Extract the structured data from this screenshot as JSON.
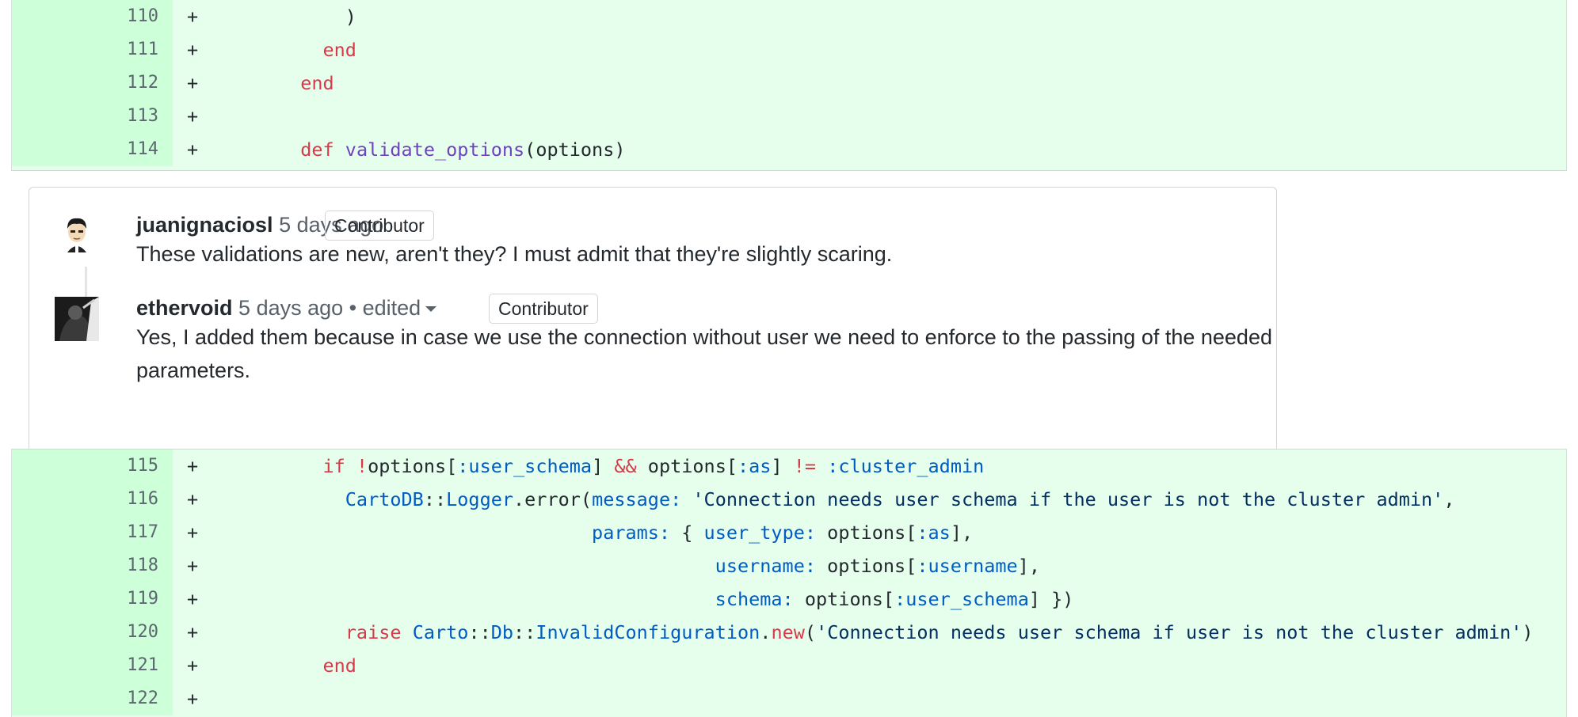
{
  "diff_top": [
    {
      "num": "110",
      "code": [
        {
          "t": "            )"
        }
      ]
    },
    {
      "num": "111",
      "code": [
        {
          "t": "          "
        },
        {
          "t": "end",
          "c": "kw"
        }
      ]
    },
    {
      "num": "112",
      "code": [
        {
          "t": "        "
        },
        {
          "t": "end",
          "c": "kw"
        }
      ]
    },
    {
      "num": "113",
      "code": []
    },
    {
      "num": "114",
      "code": [
        {
          "t": "        "
        },
        {
          "t": "def",
          "c": "kw"
        },
        {
          "t": " "
        },
        {
          "t": "validate_options",
          "c": "fn"
        },
        {
          "t": "(options)"
        }
      ]
    }
  ],
  "comments": {
    "first": {
      "author": "juanignaciosl",
      "time": "5 days ago",
      "badge": "Contributor",
      "body": "These validations are new, aren't they? I must admit that they're slightly scaring."
    },
    "second": {
      "author": "ethervoid",
      "time": "5 days ago",
      "edited": "• edited",
      "badge": "Contributor",
      "body": "Yes, I added them because in case we use the connection without user we need to enforce to the passing of the needed parameters."
    }
  },
  "diff_bottom": [
    {
      "num": "115",
      "code": [
        {
          "t": "          "
        },
        {
          "t": "if",
          "c": "kw"
        },
        {
          "t": " "
        },
        {
          "t": "!",
          "c": "kw"
        },
        {
          "t": "options["
        },
        {
          "t": ":user_schema",
          "c": "cst"
        },
        {
          "t": "] "
        },
        {
          "t": "&&",
          "c": "kw"
        },
        {
          "t": " options["
        },
        {
          "t": ":as",
          "c": "cst"
        },
        {
          "t": "] "
        },
        {
          "t": "!=",
          "c": "kw"
        },
        {
          "t": " "
        },
        {
          "t": ":cluster_admin",
          "c": "cst"
        }
      ]
    },
    {
      "num": "116",
      "code": [
        {
          "t": "            "
        },
        {
          "t": "CartoDB",
          "c": "cst"
        },
        {
          "t": "::"
        },
        {
          "t": "Logger",
          "c": "cst"
        },
        {
          "t": ".error("
        },
        {
          "t": "message:",
          "c": "cst"
        },
        {
          "t": " "
        },
        {
          "t": "'Connection needs user schema if the user is not the cluster admin'",
          "c": "str"
        },
        {
          "t": ","
        }
      ]
    },
    {
      "num": "117",
      "code": [
        {
          "t": "                                  "
        },
        {
          "t": "params:",
          "c": "cst"
        },
        {
          "t": " { "
        },
        {
          "t": "user_type:",
          "c": "cst"
        },
        {
          "t": " options["
        },
        {
          "t": ":as",
          "c": "cst"
        },
        {
          "t": "],"
        }
      ]
    },
    {
      "num": "118",
      "code": [
        {
          "t": "                                             "
        },
        {
          "t": "username:",
          "c": "cst"
        },
        {
          "t": " options["
        },
        {
          "t": ":username",
          "c": "cst"
        },
        {
          "t": "],"
        }
      ]
    },
    {
      "num": "119",
      "code": [
        {
          "t": "                                             "
        },
        {
          "t": "schema:",
          "c": "cst"
        },
        {
          "t": " options["
        },
        {
          "t": ":user_schema",
          "c": "cst"
        },
        {
          "t": "] })"
        }
      ]
    },
    {
      "num": "120",
      "code": [
        {
          "t": "            "
        },
        {
          "t": "raise",
          "c": "kw"
        },
        {
          "t": " "
        },
        {
          "t": "Carto",
          "c": "cst"
        },
        {
          "t": "::"
        },
        {
          "t": "Db",
          "c": "cst"
        },
        {
          "t": "::"
        },
        {
          "t": "InvalidConfiguration",
          "c": "cst"
        },
        {
          "t": "."
        },
        {
          "t": "new",
          "c": "kw"
        },
        {
          "t": "("
        },
        {
          "t": "'Connection needs user schema if user is not the cluster admin'",
          "c": "str"
        },
        {
          "t": ")"
        }
      ]
    },
    {
      "num": "121",
      "code": [
        {
          "t": "          "
        },
        {
          "t": "end",
          "c": "kw"
        }
      ]
    },
    {
      "num": "122",
      "code": []
    }
  ],
  "icons": {
    "avatar_1": "avatar-cartoon-man",
    "avatar_2": "avatar-photo",
    "caret": "chevron-down-icon"
  },
  "colors": {
    "added_bg": "#e6ffed",
    "added_num_bg": "#cdffd8",
    "keyword": "#d73a49",
    "function": "#6f42c1",
    "constant": "#005cc5",
    "string": "#032f62"
  }
}
